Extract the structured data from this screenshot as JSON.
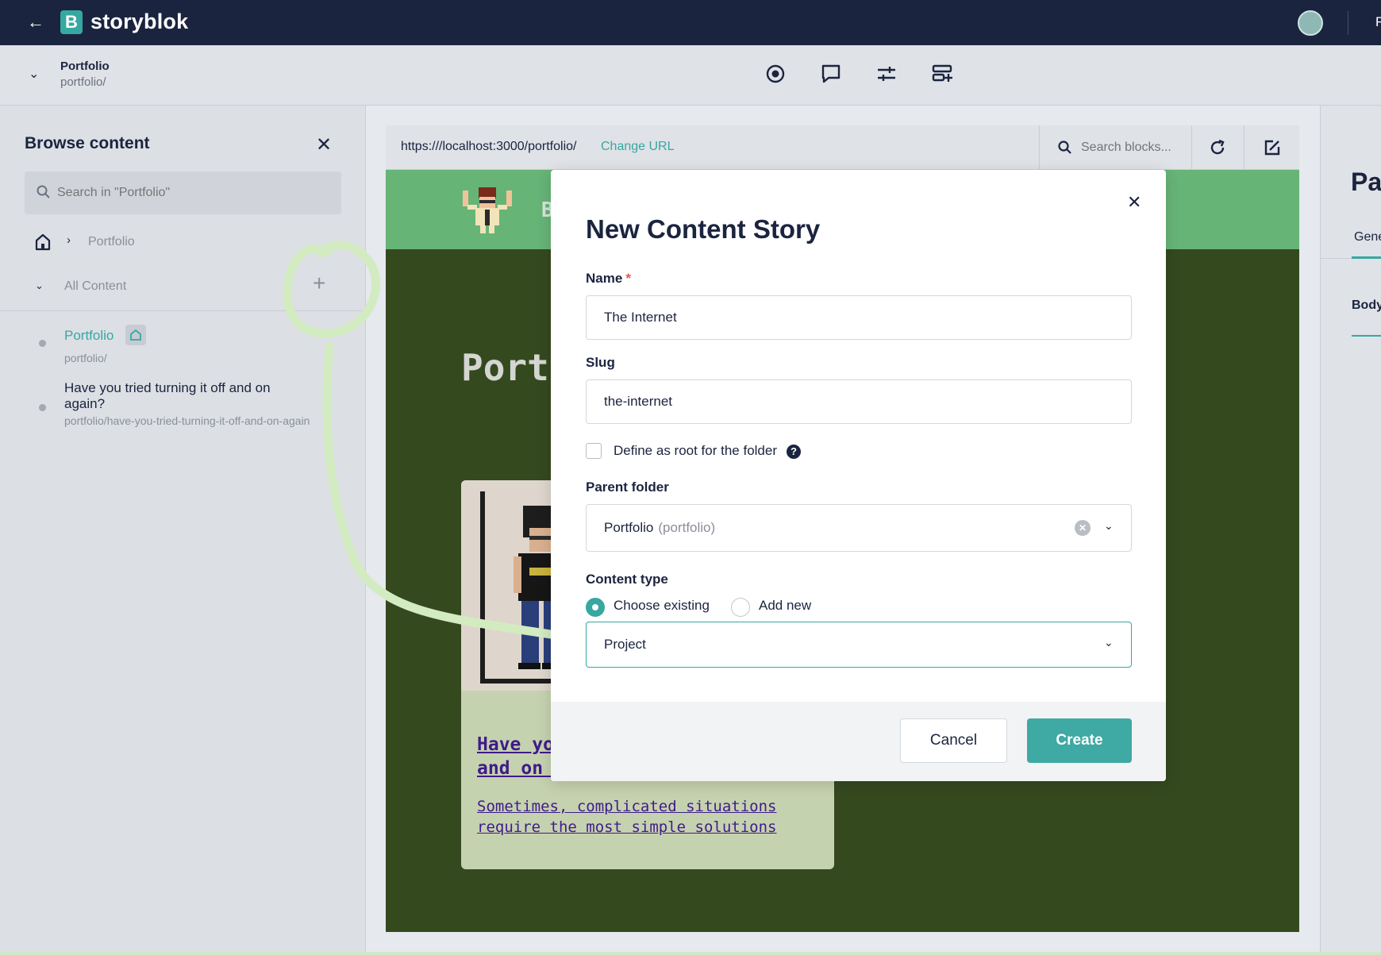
{
  "app": {
    "brand": "storyblok",
    "user_initial": "F",
    "accent": "#36a8a1"
  },
  "story": {
    "title": "Portfolio",
    "slug": "portfolio/"
  },
  "toolbar": {
    "icons": [
      "target-icon",
      "comment-icon",
      "sliders-icon",
      "blocks-add-icon"
    ]
  },
  "browse": {
    "title": "Browse content",
    "search_placeholder": "Search in \"Portfolio\"",
    "breadcrumb": "Portfolio",
    "section": "All Content",
    "items": [
      {
        "title": "Portfolio",
        "slug": "portfolio/"
      },
      {
        "title": "Have you tried turning it off and on again?",
        "slug": "portfolio/have-you-tried-turning-it-off-and-on-again"
      }
    ]
  },
  "preview": {
    "url": "https:///localhost:3000/portfolio/",
    "change_url": "Change URL",
    "search_placeholder": "Search blocks...",
    "header_letter": "B",
    "heading": "Portfolio",
    "card_title": "Have you tried turning it off and on again?",
    "card_desc": "Sometimes, complicated situations require the most simple solutions"
  },
  "right_panel": {
    "title": "Pa",
    "tab": "Gene",
    "field": "Body"
  },
  "modal": {
    "title": "New Content Story",
    "name_label": "Name",
    "name_required": "*",
    "name_value": "The Internet",
    "slug_label": "Slug",
    "slug_value": "the-internet",
    "root_label": "Define as root for the folder",
    "root_checked": false,
    "help": "?",
    "parent_label": "Parent folder",
    "parent_value": "Portfolio",
    "parent_sub": "(portfolio)",
    "content_type_label": "Content type",
    "choose_existing": "Choose existing",
    "add_new": "Add new",
    "content_type_value": "Project",
    "cancel": "Cancel",
    "create": "Create"
  }
}
